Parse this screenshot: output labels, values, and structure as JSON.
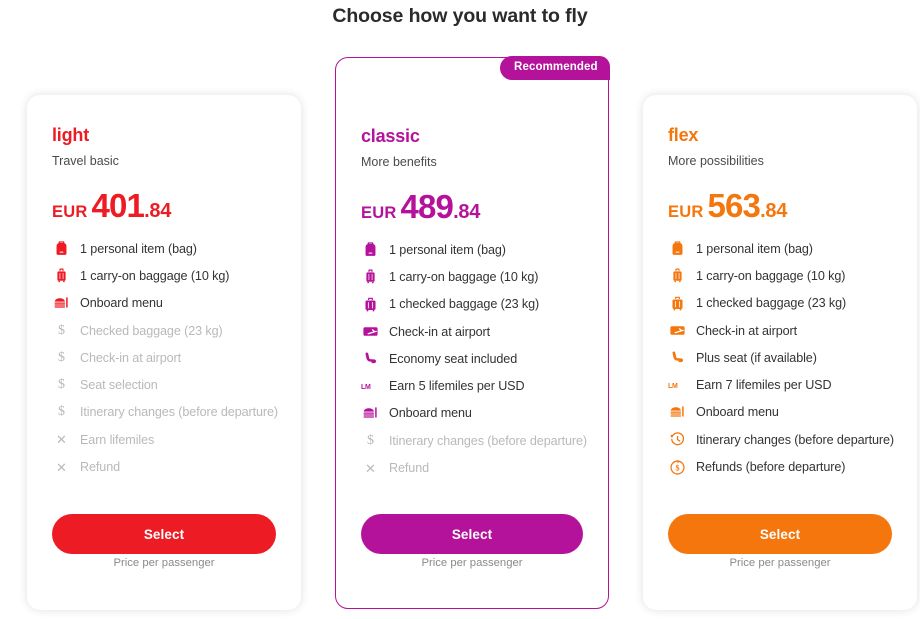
{
  "header": {
    "title": "Choose how you want to fly"
  },
  "colors": {
    "light": "#ed1c24",
    "classic": "#b5129b",
    "flex": "#f4760d",
    "muted": "#b9b9bd",
    "text": "#333333"
  },
  "cards": [
    {
      "id": "light",
      "name": "light",
      "tagline": "Travel basic",
      "currency": "EUR",
      "price_integer": "401",
      "price_decimal": ".84",
      "accent": "#ed1c24",
      "recommended": false,
      "badge_label": "",
      "select_label": "Select",
      "footnote": "Price per passenger",
      "features": [
        {
          "icon": "backpack-icon",
          "label": "1 personal item (bag)",
          "included": true
        },
        {
          "icon": "carryon-bag-icon",
          "label": "1 carry-on baggage (10 kg)",
          "included": true
        },
        {
          "icon": "onboard-menu-icon",
          "label": "Onboard menu",
          "included": true
        },
        {
          "icon": "dollar-icon",
          "label": "Checked baggage (23 kg)",
          "included": false
        },
        {
          "icon": "dollar-icon",
          "label": "Check-in at airport",
          "included": false
        },
        {
          "icon": "dollar-icon",
          "label": "Seat selection",
          "included": false
        },
        {
          "icon": "dollar-icon",
          "label": "Itinerary changes (before departure)",
          "included": false
        },
        {
          "icon": "cross-icon",
          "label": "Earn lifemiles",
          "included": false
        },
        {
          "icon": "cross-icon",
          "label": "Refund",
          "included": false
        }
      ]
    },
    {
      "id": "classic",
      "name": "classic",
      "tagline": "More benefits",
      "currency": "EUR",
      "price_integer": "489",
      "price_decimal": ".84",
      "accent": "#b5129b",
      "recommended": true,
      "badge_label": "Recommended",
      "select_label": "Select",
      "footnote": "Price per passenger",
      "features": [
        {
          "icon": "backpack-icon",
          "label": "1 personal item (bag)",
          "included": true
        },
        {
          "icon": "carryon-bag-icon",
          "label": "1 carry-on baggage (10 kg)",
          "included": true
        },
        {
          "icon": "checked-bag-icon",
          "label": "1 checked baggage (23 kg)",
          "included": true
        },
        {
          "icon": "boarding-pass-icon",
          "label": "Check-in at airport",
          "included": true
        },
        {
          "icon": "seat-icon",
          "label": "Economy seat included",
          "included": true
        },
        {
          "icon": "lifemiles-icon",
          "label": "Earn 5 lifemiles per USD",
          "included": true
        },
        {
          "icon": "onboard-menu-icon",
          "label": "Onboard menu",
          "included": true
        },
        {
          "icon": "dollar-icon",
          "label": "Itinerary changes (before departure)",
          "included": false
        },
        {
          "icon": "cross-icon",
          "label": "Refund",
          "included": false
        }
      ]
    },
    {
      "id": "flex",
      "name": "flex",
      "tagline": "More possibilities",
      "currency": "EUR",
      "price_integer": "563",
      "price_decimal": ".84",
      "accent": "#f4760d",
      "recommended": false,
      "badge_label": "",
      "select_label": "Select",
      "footnote": "Price per passenger",
      "features": [
        {
          "icon": "backpack-icon",
          "label": "1 personal item (bag)",
          "included": true
        },
        {
          "icon": "carryon-bag-icon",
          "label": "1 carry-on baggage (10 kg)",
          "included": true
        },
        {
          "icon": "checked-bag-icon",
          "label": "1 checked baggage (23 kg)",
          "included": true
        },
        {
          "icon": "boarding-pass-icon",
          "label": "Check-in at airport",
          "included": true
        },
        {
          "icon": "seat-icon",
          "label": "Plus seat (if available)",
          "included": true
        },
        {
          "icon": "lifemiles-icon",
          "label": "Earn 7 lifemiles per USD",
          "included": true
        },
        {
          "icon": "onboard-menu-icon",
          "label": "Onboard menu",
          "included": true
        },
        {
          "icon": "clock-icon",
          "label": "Itinerary changes (before departure)",
          "included": true
        },
        {
          "icon": "refund-icon",
          "label": "Refunds (before departure)",
          "included": true
        }
      ]
    }
  ]
}
